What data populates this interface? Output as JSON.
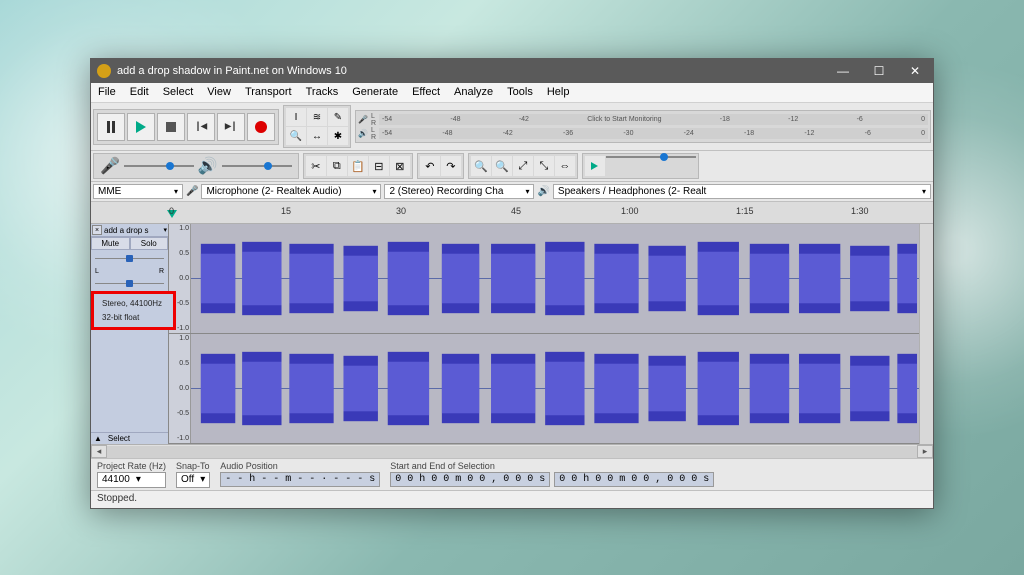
{
  "window": {
    "title": "add a drop shadow in Paint.net on Windows 10",
    "controls": {
      "min": "—",
      "max": "☐",
      "close": "✕"
    }
  },
  "menu": [
    "File",
    "Edit",
    "Select",
    "View",
    "Transport",
    "Tracks",
    "Generate",
    "Effect",
    "Analyze",
    "Tools",
    "Help"
  ],
  "meters": {
    "rec_hint": "Click to Start Monitoring",
    "ticks_top": [
      "-54",
      "-48",
      "-42",
      "",
      "",
      "-18",
      "-12",
      "-6",
      "0"
    ],
    "ticks_bot": [
      "-54",
      "-48",
      "-42",
      "-36",
      "-30",
      "-24",
      "-18",
      "-12",
      "-6",
      "0"
    ],
    "lr": [
      "L",
      "R"
    ]
  },
  "devices": {
    "host": "MME",
    "input": "Microphone (2- Realtek Audio)",
    "channels": "2 (Stereo) Recording Cha",
    "output": "Speakers / Headphones (2- Realt"
  },
  "timeline": [
    "0",
    "15",
    "30",
    "45",
    "1:00",
    "1:15",
    "1:30"
  ],
  "track": {
    "name": "add a drop s",
    "mute": "Mute",
    "solo": "Solo",
    "pan_left": "L",
    "pan_right": "R",
    "info1": "Stereo, 44100Hz",
    "info2": "32-bit float",
    "select": "Select",
    "collapse": "▲"
  },
  "wave_scale": [
    "1.0",
    "0.5",
    "0.0",
    "-0.5",
    "-1.0"
  ],
  "bottom": {
    "rate_label": "Project Rate (Hz)",
    "rate_value": "44100",
    "snap_label": "Snap-To",
    "snap_value": "Off",
    "pos_label": "Audio Position",
    "pos_value": "- - h - -  m - - · - - -  s",
    "sel_label": "Start and End of Selection",
    "sel_start": "0 0 h 0 0  m 0 0 , 0 0 0  s",
    "sel_end": "0 0 h 0 0  m 0 0 , 0 0 0  s"
  },
  "status": "Stopped.",
  "icons": {
    "mic": "🎤",
    "speaker": "🔊",
    "cut": "✂",
    "copy": "⧉",
    "paste": "📋",
    "undo": "↶",
    "redo": "↷",
    "zoomin": "🔍+",
    "zoomout": "🔍-",
    "cursor": "I",
    "envelope": "≋",
    "draw": "✎",
    "zoom": "🔍",
    "timeshift": "↔",
    "multi": "✱"
  }
}
